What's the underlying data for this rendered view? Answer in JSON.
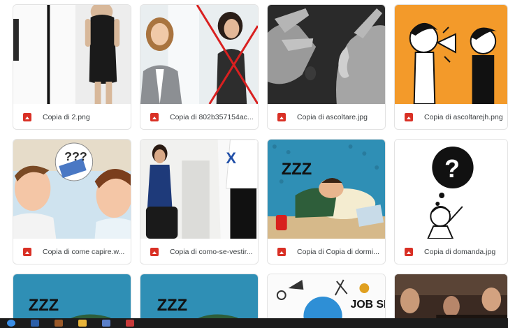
{
  "files": [
    {
      "name": "Copia di 2.png",
      "icon": "image-file-icon"
    },
    {
      "name": "Copia di 802b357154ac...",
      "icon": "image-file-icon"
    },
    {
      "name": "Copia di ascoltare.jpg",
      "icon": "image-file-icon"
    },
    {
      "name": "Copia di ascoltarejh.png",
      "icon": "image-file-icon"
    },
    {
      "name": "Copia di come capire.w...",
      "icon": "image-file-icon"
    },
    {
      "name": "Copia di como-se-vestir...",
      "icon": "image-file-icon"
    },
    {
      "name": "Copia di Copia di dormi...",
      "icon": "image-file-icon"
    },
    {
      "name": "Copia di domanda.jpg",
      "icon": "image-file-icon"
    }
  ],
  "thumb_text": {
    "zzz": "ZZZ",
    "x_mark": "X",
    "question_badge": "???",
    "question": "?",
    "job_search": "JOB SEAR"
  },
  "colors": {
    "file_icon": "#d93025",
    "taskbar": "#1c1c1c",
    "orange_bg": "#f39a2a",
    "comic_blue": "#2f8fb5"
  },
  "taskbar": {
    "icons": [
      "windows-icon",
      "app-icon",
      "app-icon",
      "folder-icon",
      "app-icon",
      "app-icon"
    ]
  }
}
